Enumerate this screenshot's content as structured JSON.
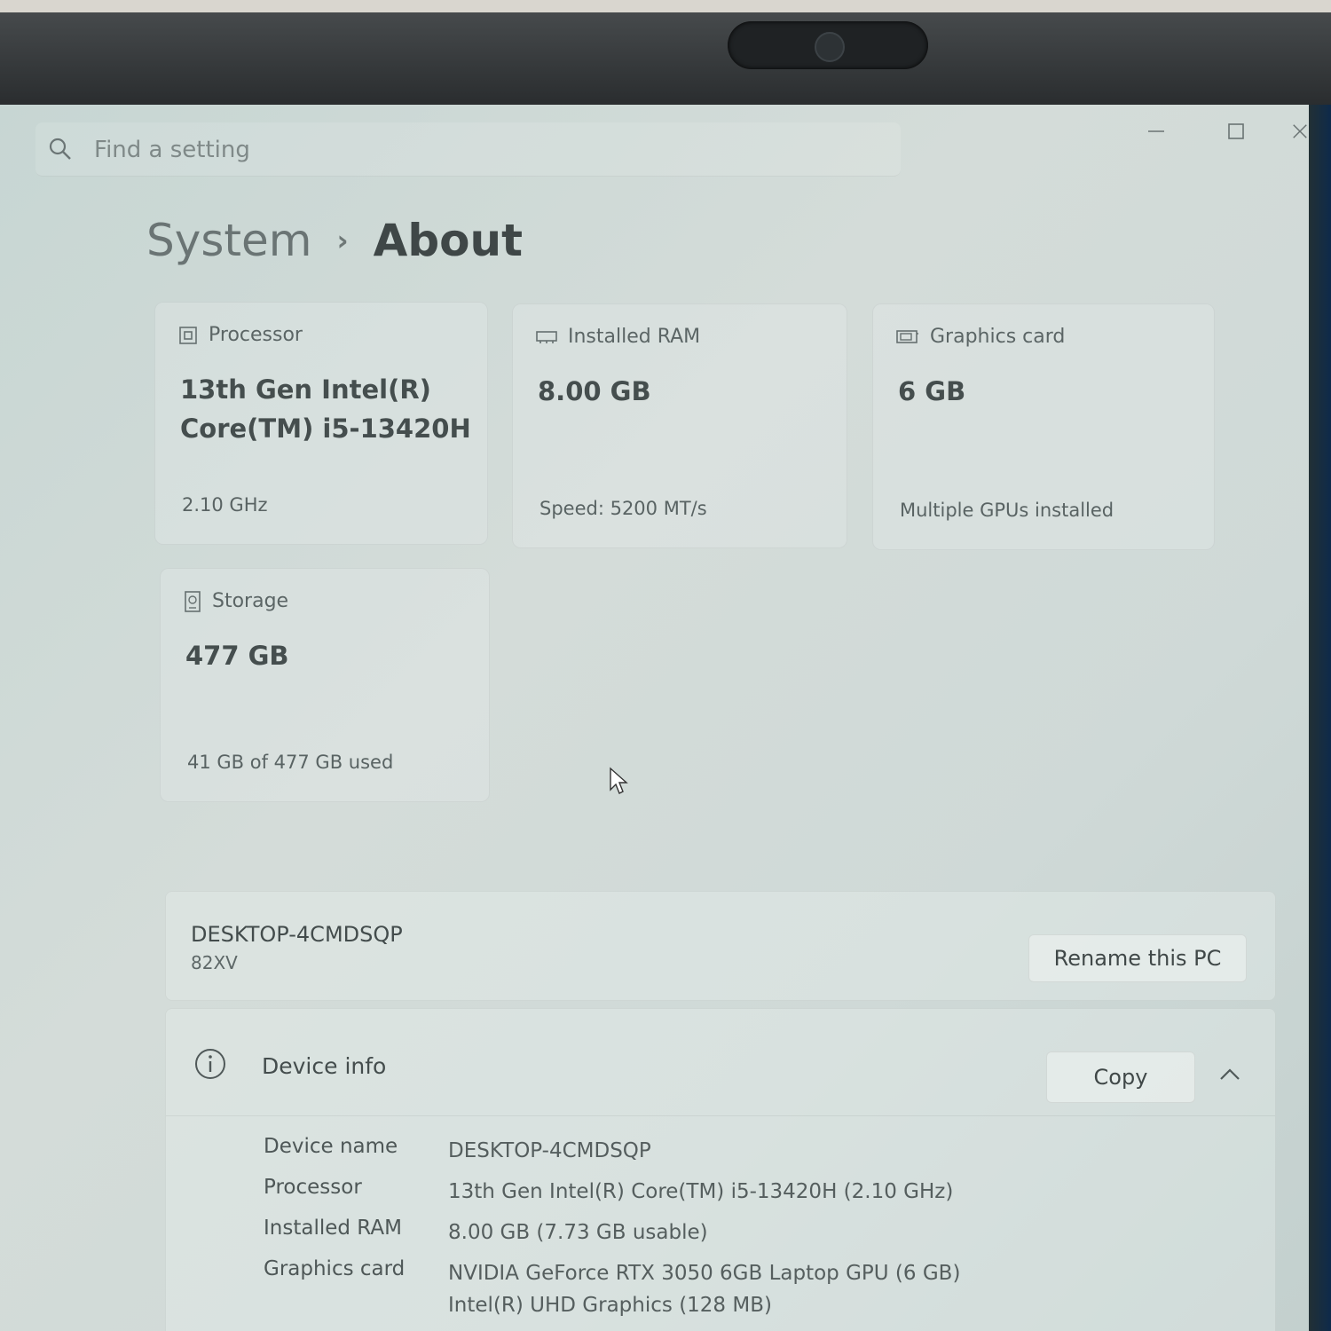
{
  "search": {
    "placeholder": "Find a setting"
  },
  "window_controls": {
    "minimize": "minimize-icon",
    "maximize": "maximize-icon",
    "close": "close-icon"
  },
  "breadcrumb": {
    "parent": "System",
    "separator": "›",
    "current": "About"
  },
  "specs": {
    "processor": {
      "label": "Processor",
      "value": "13th Gen Intel(R) Core(TM) i5-13420H",
      "sub": "2.10 GHz",
      "icon": "processor-icon"
    },
    "ram": {
      "label": "Installed RAM",
      "value": "8.00 GB",
      "sub": "Speed: 5200 MT/s",
      "icon": "ram-icon"
    },
    "graphics": {
      "label": "Graphics card",
      "value": "6 GB",
      "sub": "Multiple GPUs installed",
      "icon": "graphics-card-icon"
    },
    "storage": {
      "label": "Storage",
      "value": "477 GB",
      "sub": "41 GB of 477 GB used",
      "icon": "storage-icon"
    }
  },
  "pc": {
    "name": "DESKTOP-4CMDSQP",
    "model": "82XV",
    "rename_label": "Rename this PC"
  },
  "device_info": {
    "title": "Device info",
    "copy_label": "Copy",
    "rows": [
      {
        "label": "Device name",
        "value": "DESKTOP-4CMDSQP"
      },
      {
        "label": "Processor",
        "value": "13th Gen Intel(R) Core(TM) i5-13420H (2.10 GHz)"
      },
      {
        "label": "Installed RAM",
        "value": "8.00 GB (7.73 GB usable)"
      },
      {
        "label": "Graphics card",
        "value": "NVIDIA GeForce RTX 3050 6GB Laptop GPU (6 GB)",
        "value2": "Intel(R) UHD Graphics (128 MB)"
      }
    ]
  },
  "colors": {
    "screen": "#cfd9d7",
    "text": "#454e4e",
    "bezel": "#2e3234"
  }
}
